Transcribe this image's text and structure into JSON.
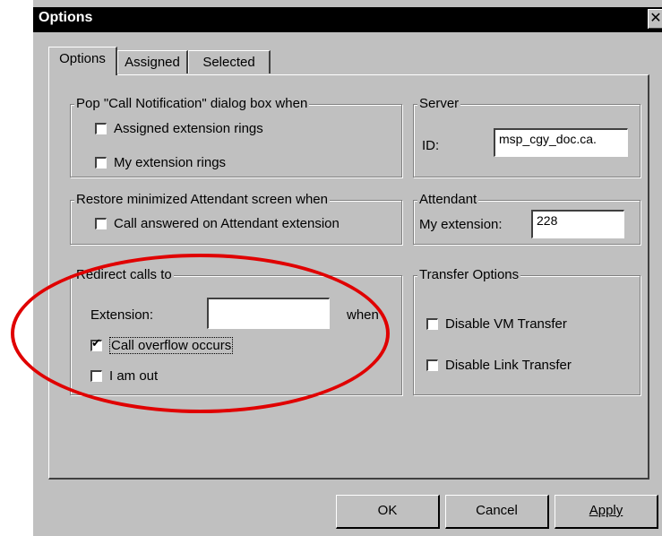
{
  "window": {
    "title": "Options",
    "close_glyph": "✕"
  },
  "tabs": [
    {
      "label": "Options",
      "active": true
    },
    {
      "label": "Assigned",
      "active": false
    },
    {
      "label": "Selected",
      "active": false
    }
  ],
  "pop_group": {
    "legend": "Pop \"Call Notification\" dialog box when",
    "assigned_label": "Assigned extension rings",
    "assigned_checked": false,
    "my_label": "My extension rings",
    "my_checked": false
  },
  "server_group": {
    "legend": "Server",
    "id_label": "ID:",
    "id_value": "msp_cgy_doc.ca."
  },
  "restore_group": {
    "legend": "Restore minimized Attendant screen when",
    "answered_label": "Call answered on Attendant extension",
    "answered_checked": false
  },
  "attendant_group": {
    "legend": "Attendant",
    "ext_label": "My extension:",
    "ext_value": "228"
  },
  "redirect_group": {
    "legend": "Redirect calls to",
    "extension_label": "Extension:",
    "extension_value": "",
    "when_label": "when",
    "overflow_label": "Call overflow occurs",
    "overflow_checked": true,
    "out_label": "I am out",
    "out_checked": false
  },
  "transfer_group": {
    "legend": "Transfer Options",
    "vm_label": "Disable VM Transfer",
    "vm_checked": false,
    "link_label": "Disable Link Transfer",
    "link_checked": false
  },
  "buttons": {
    "ok": "OK",
    "cancel": "Cancel",
    "apply": "Apply"
  },
  "colors": {
    "dialog_bg": "#c0c0c0",
    "titlebar": "#000000",
    "annotation": "#e00000"
  }
}
